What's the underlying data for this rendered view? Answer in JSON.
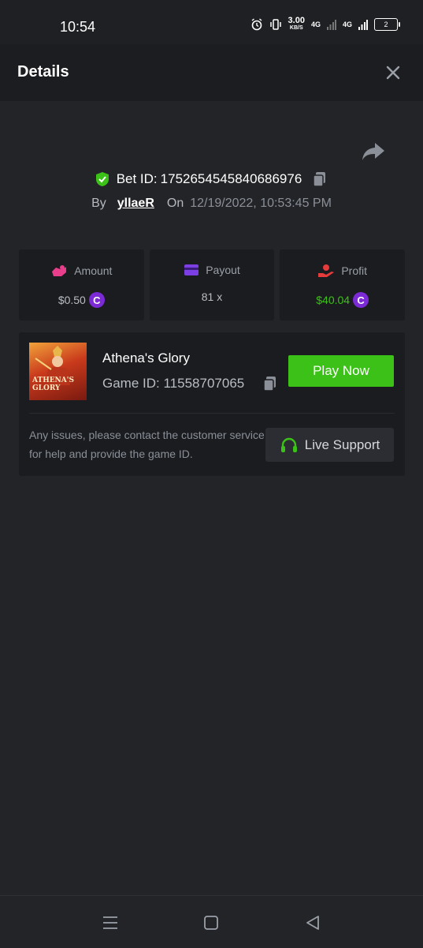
{
  "status_bar": {
    "time": "10:54",
    "speed_value": "3.00",
    "speed_unit": "KB/S",
    "net1": "4G",
    "net2": "4G",
    "battery": "2"
  },
  "header": {
    "title": "Details",
    "close_icon": "close-icon"
  },
  "bet": {
    "id_label": "Bet ID:",
    "id_value": "1752654545840686976",
    "by_label": "By",
    "username": "yllaeR",
    "on_label": "On",
    "datetime": "12/19/2022, 10:53:45 PM"
  },
  "stats": [
    {
      "label": "Amount",
      "value": "$0.50",
      "icon": "money-hand-icon",
      "color": "#b9bdc4",
      "show_coin": true
    },
    {
      "label": "Payout",
      "value": "81 x",
      "icon": "card-icon",
      "color": "#b9bdc4",
      "show_coin": false
    },
    {
      "label": "Profit",
      "value": "$40.04",
      "icon": "profit-hand-icon",
      "color": "#3bc117",
      "show_coin": true
    }
  ],
  "coin_symbol": "C",
  "game": {
    "thumb_text": "ATHENA'S GLORY",
    "name": "Athena's Glory",
    "id_label": "Game ID:",
    "id_value": "11558707065",
    "play_label": "Play Now",
    "support_text": "Any issues, please contact the customer service for help and provide the game ID.",
    "support_label": "Live Support"
  },
  "colors": {
    "accent_green": "#3bc117",
    "coin_purple": "#7b2ad6",
    "background": "#232427",
    "card": "#1b1c1f"
  }
}
